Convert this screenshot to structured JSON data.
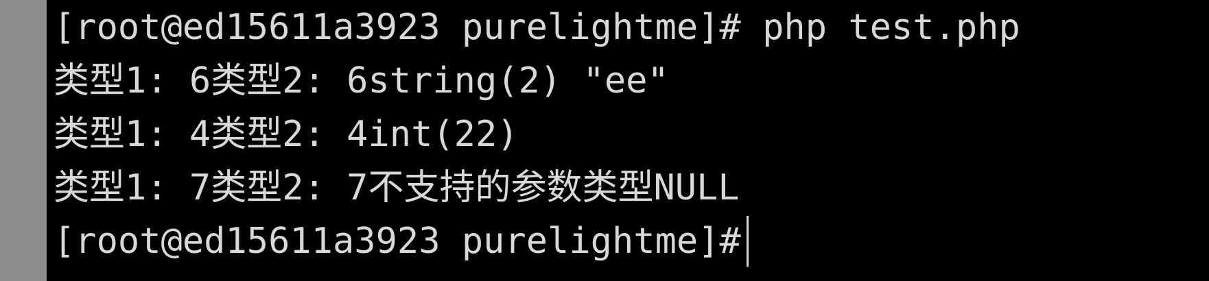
{
  "terminal": {
    "lines": [
      {
        "prompt": "[root@ed15611a3923 purelightme]#",
        "command": " php test.php"
      },
      {
        "text": "类型1: 6类型2: 6string(2) \"ee\""
      },
      {
        "text": "类型1: 4类型2: 4int(22)"
      },
      {
        "text": "类型1: 7类型2: 7不支持的参数类型NULL"
      },
      {
        "prompt": "[root@ed15611a3923 purelightme]#",
        "command": ""
      }
    ]
  },
  "colors": {
    "background": "#000000",
    "foreground": "#d8d8d8",
    "gutter": "#8c8c8c"
  }
}
